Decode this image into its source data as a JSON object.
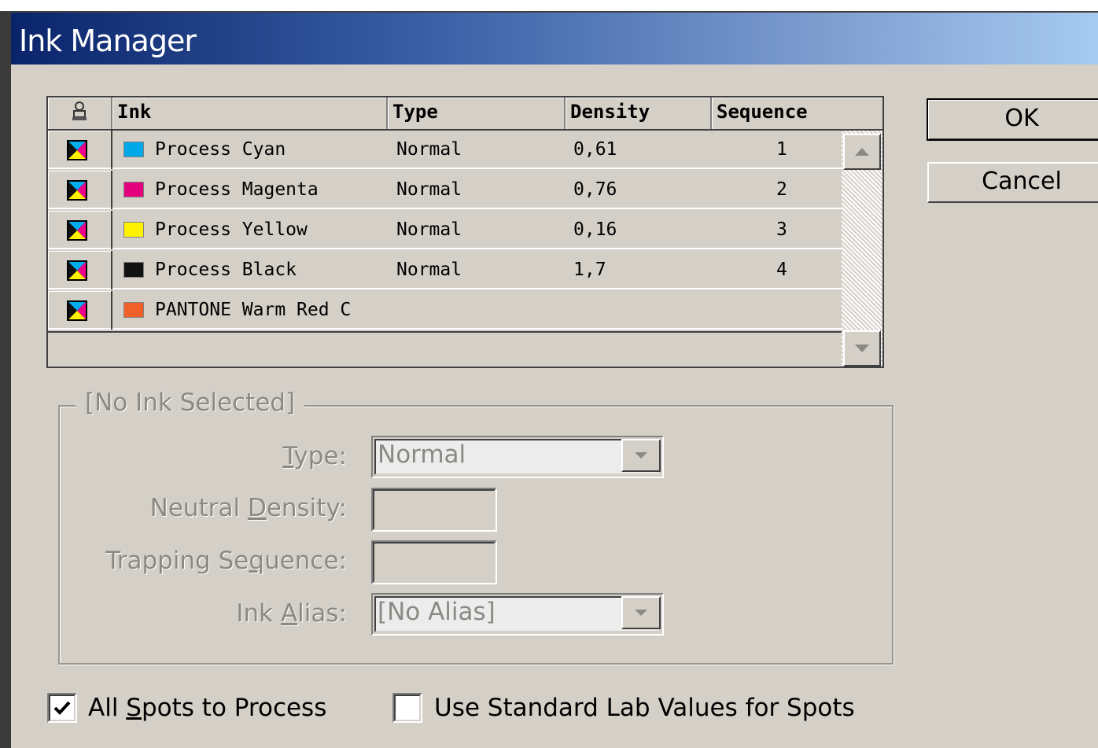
{
  "window": {
    "title": "Ink Manager"
  },
  "table": {
    "columns": {
      "icon": "printer-icon",
      "ink": "Ink",
      "type": "Type",
      "density": "Density",
      "sequence": "Sequence"
    },
    "rows": [
      {
        "name": "Process Cyan",
        "color": "#00a8e8",
        "type": "Normal",
        "density": "0,61",
        "sequence": "1"
      },
      {
        "name": "Process Magenta",
        "color": "#e4007c",
        "type": "Normal",
        "density": "0,76",
        "sequence": "2"
      },
      {
        "name": "Process Yellow",
        "color": "#fff200",
        "type": "Normal",
        "density": "0,16",
        "sequence": "3"
      },
      {
        "name": "Process Black",
        "color": "#111111",
        "type": "Normal",
        "density": "1,7",
        "sequence": "4"
      },
      {
        "name": "PANTONE Warm Red C",
        "color": "#f0602a",
        "type": "",
        "density": "",
        "sequence": ""
      }
    ]
  },
  "buttons": {
    "ok": "OK",
    "cancel": "Cancel"
  },
  "group": {
    "legend": "[No Ink Selected]",
    "type_label": "Type:",
    "type_value": "Normal",
    "density_label": "Neutral Density:",
    "density_value": "",
    "sequence_label": "Trapping Sequence:",
    "sequence_value": "",
    "alias_label": "Ink Alias:",
    "alias_value": "[No Alias]"
  },
  "options": {
    "all_spots": {
      "label": "All Spots to Process",
      "checked": true
    },
    "lab_values": {
      "label": "Use Standard Lab Values for Spots",
      "checked": false
    }
  }
}
